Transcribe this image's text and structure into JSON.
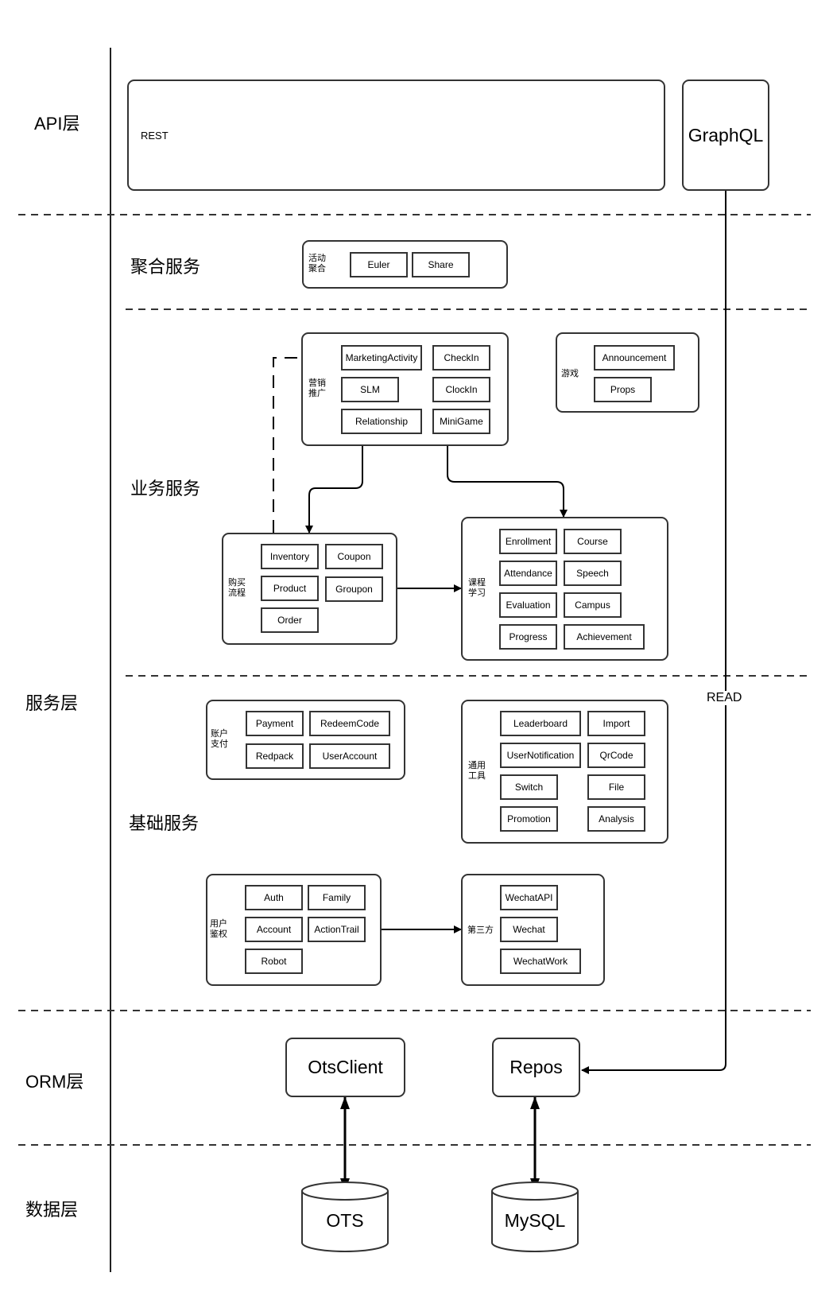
{
  "layers": {
    "api": "API层",
    "service": "服务层",
    "orm": "ORM层",
    "data": "数据层"
  },
  "sections": {
    "aggregate": "聚合服务",
    "business": "业务服务",
    "foundation": "基础服务"
  },
  "api": {
    "rest": "REST",
    "graphql": "GraphQL",
    "read_edge_label": "READ"
  },
  "groups": {
    "activity_aggregate": {
      "label": "活动\n聚合",
      "modules": [
        "Euler",
        "Share"
      ]
    },
    "marketing": {
      "label": "营销\n推广",
      "modules": [
        "MarketingActivity",
        "CheckIn",
        "SLM",
        "ClockIn",
        "Relationship",
        "MiniGame"
      ]
    },
    "game": {
      "label": "游戏",
      "modules": [
        "Announcement",
        "Props"
      ]
    },
    "purchase": {
      "label": "购买\n流程",
      "modules": [
        "Inventory",
        "Coupon",
        "Product",
        "Groupon",
        "Order"
      ]
    },
    "course": {
      "label": "课程\n学习",
      "modules": [
        "Enrollment",
        "Course",
        "Attendance",
        "Speech",
        "Evaluation",
        "Campus",
        "Progress",
        "Achievement"
      ]
    },
    "account_payment": {
      "label": "账户\n支付",
      "modules": [
        "Payment",
        "RedeemCode",
        "Redpack",
        "UserAccount"
      ]
    },
    "common_tools": {
      "label": "通用\n工具",
      "modules": [
        "Leaderboard",
        "Import",
        "UserNotification",
        "QrCode",
        "Switch",
        "File",
        "Promotion",
        "Analysis"
      ]
    },
    "user_auth": {
      "label": "用户\n鉴权",
      "modules": [
        "Auth",
        "Family",
        "Account",
        "ActionTrail",
        "Robot"
      ]
    },
    "third_party": {
      "label": "第三方",
      "modules": [
        "WechatAPI",
        "Wechat",
        "WechatWork"
      ]
    }
  },
  "orm": {
    "ots_client": "OtsClient",
    "repos": "Repos"
  },
  "databases": {
    "ots": "OTS",
    "mysql": "MySQL"
  },
  "colors": {
    "stroke": "#333333",
    "text": "#000000",
    "background": "#ffffff"
  }
}
